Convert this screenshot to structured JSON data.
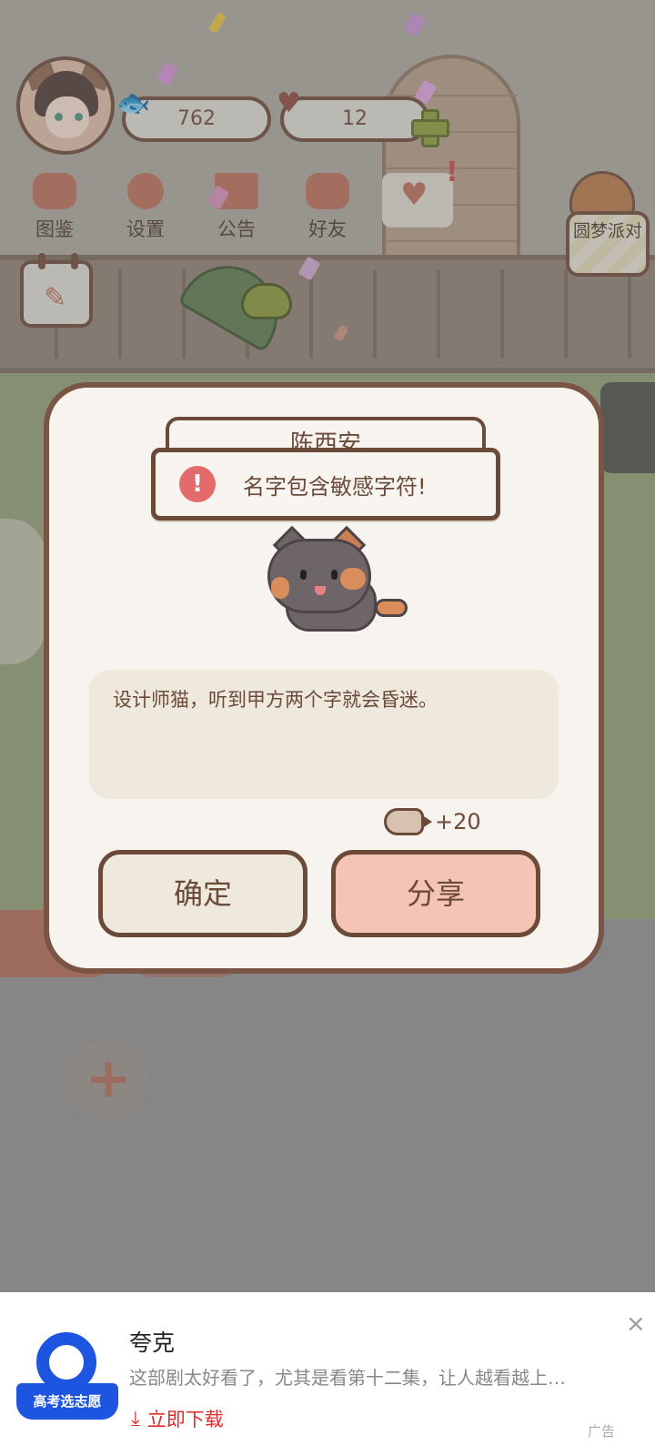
{
  "hud": {
    "fish_count": "762",
    "heart_count": "12"
  },
  "menu": {
    "items": [
      {
        "label": "图鉴"
      },
      {
        "label": "设置"
      },
      {
        "label": "公告"
      },
      {
        "label": "好友"
      }
    ],
    "party_label": "圆梦派对"
  },
  "dialog": {
    "name_value": "陈西安",
    "error_icon": "!",
    "error_message": "名字包含敏感字符!",
    "description": "设计师猫，听到甲方两个字就会昏迷。",
    "reward_amount": "+20",
    "confirm_label": "确定",
    "share_label": "分享"
  },
  "ad": {
    "title": "夸克",
    "description": "这部剧太好看了，尤其是看第十二集，让人越看越上…",
    "cta": "立即下载",
    "close": "×",
    "label": "广告",
    "logo_text": "高考选志愿"
  },
  "colors": {
    "dialog_bg": "#f7f3ee",
    "border_brown": "#6b4a3a",
    "share_button": "#f5c4b5",
    "error_red": "#e46b6b",
    "cta_red": "#e02c2c",
    "quark_blue": "#1d55e0"
  }
}
